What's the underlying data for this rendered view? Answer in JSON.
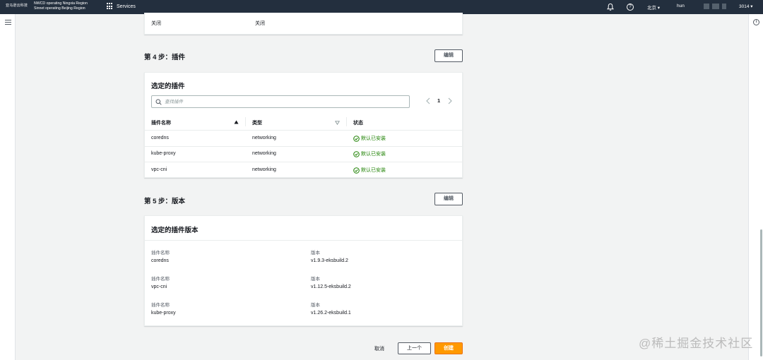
{
  "topbar": {
    "brand_logo": "亚马逊云科技",
    "region_line1": "NWCD operating Ningxia Region",
    "region_line2": "Sinnet operating Beijing Region",
    "services_label": "Services",
    "region_selector": "北京 ▾",
    "user_label": "hun",
    "account_suffix": "3014 ▾"
  },
  "top_card": {
    "labels": [
      "",
      ""
    ],
    "values": [
      "关闭",
      "关闭"
    ]
  },
  "step4": {
    "title": "第 4 步：插件",
    "edit_label": "编辑",
    "card_title": "选定的插件",
    "search_placeholder": "查找插件",
    "page_number": "1",
    "columns": [
      "插件名称",
      "类型",
      "状态"
    ],
    "rows": [
      {
        "name": "coredns",
        "type": "networking",
        "status": "默认已安装"
      },
      {
        "name": "kube-proxy",
        "type": "networking",
        "status": "默认已安装"
      },
      {
        "name": "vpc-cni",
        "type": "networking",
        "status": "默认已安装"
      }
    ]
  },
  "step5": {
    "title": "第 5 步：版本",
    "edit_label": "编辑",
    "card_title": "选定的插件版本",
    "items": [
      {
        "name_label": "插件名称",
        "name": "coredns",
        "version_label": "版本",
        "version": "v1.9.3-eksbuild.2"
      },
      {
        "name_label": "插件名称",
        "name": "vpc-cni",
        "version_label": "版本",
        "version": "v1.12.5-eksbuild.2"
      },
      {
        "name_label": "插件名称",
        "name": "kube-proxy",
        "version_label": "版本",
        "version": "v1.26.2-eksbuild.1"
      }
    ]
  },
  "footer": {
    "cancel": "取消",
    "previous": "上一个",
    "create": "创建"
  },
  "watermark": "@稀土掘金技术社区",
  "colors": {
    "nav_bg": "#232f3e",
    "primary": "#ff9900",
    "success": "#1d8102"
  }
}
